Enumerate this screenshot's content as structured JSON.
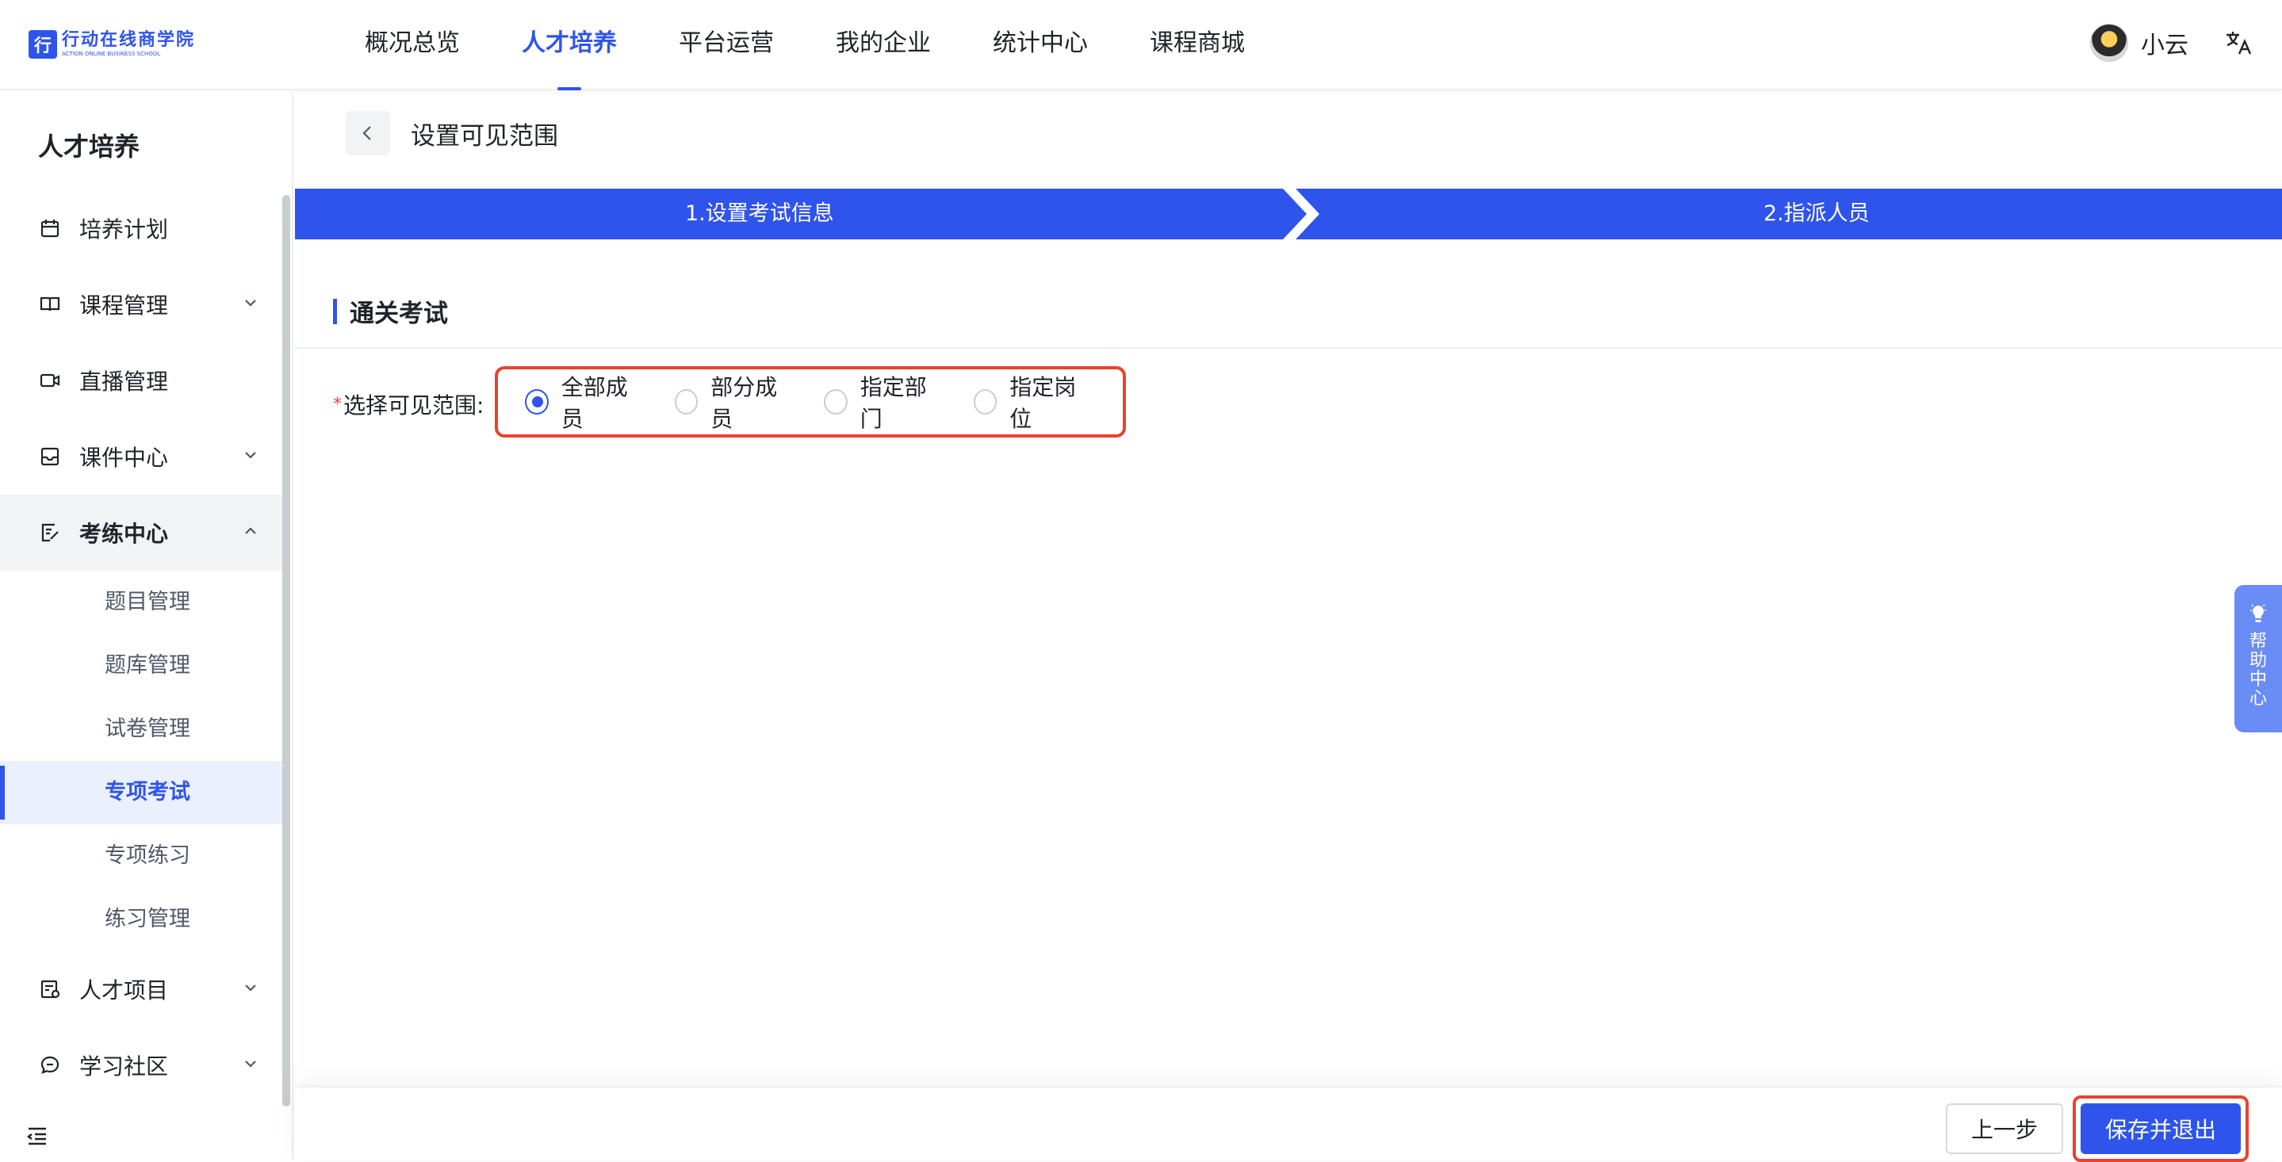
{
  "header": {
    "logo_cn": "行动在线商学院",
    "logo_en": "ACTION ONLINE BUSINESS SCHOOL",
    "nav": [
      "概况总览",
      "人才培养",
      "平台运营",
      "我的企业",
      "统计中心",
      "课程商城"
    ],
    "active_nav": "人才培养",
    "user_name": "小云"
  },
  "sidebar": {
    "title": "人才培养",
    "items": [
      {
        "label": "培养计划",
        "icon": "calendar-icon",
        "has_children": false
      },
      {
        "label": "课程管理",
        "icon": "book-icon",
        "has_children": true
      },
      {
        "label": "直播管理",
        "icon": "video-camera-icon",
        "has_children": false
      },
      {
        "label": "课件中心",
        "icon": "inbox-icon",
        "has_children": true
      },
      {
        "label": "考练中心",
        "icon": "exam-icon",
        "has_children": true,
        "expanded": true
      },
      {
        "label": "人才项目",
        "icon": "project-icon",
        "has_children": true
      },
      {
        "label": "学习社区",
        "icon": "chat-icon",
        "has_children": true
      }
    ],
    "sub_items": [
      "题目管理",
      "题库管理",
      "试卷管理",
      "专项考试",
      "专项练习",
      "练习管理"
    ],
    "active_sub": "专项考试"
  },
  "page": {
    "title": "设置可见范围",
    "steps": [
      "1.设置考试信息",
      "2.指派人员"
    ],
    "section_title": "通关考试",
    "form_label": "选择可见范围:",
    "required_mark": "*",
    "radio_options": [
      "全部成员",
      "部分成员",
      "指定部门",
      "指定岗位"
    ],
    "selected_option": "全部成员"
  },
  "help": {
    "label": "帮助中心"
  },
  "footer": {
    "prev_label": "上一步",
    "save_label": "保存并退出"
  },
  "colors": {
    "primary": "#2f54eb",
    "highlight_border": "#e8432d",
    "help_tab": "#6a8cf7"
  }
}
